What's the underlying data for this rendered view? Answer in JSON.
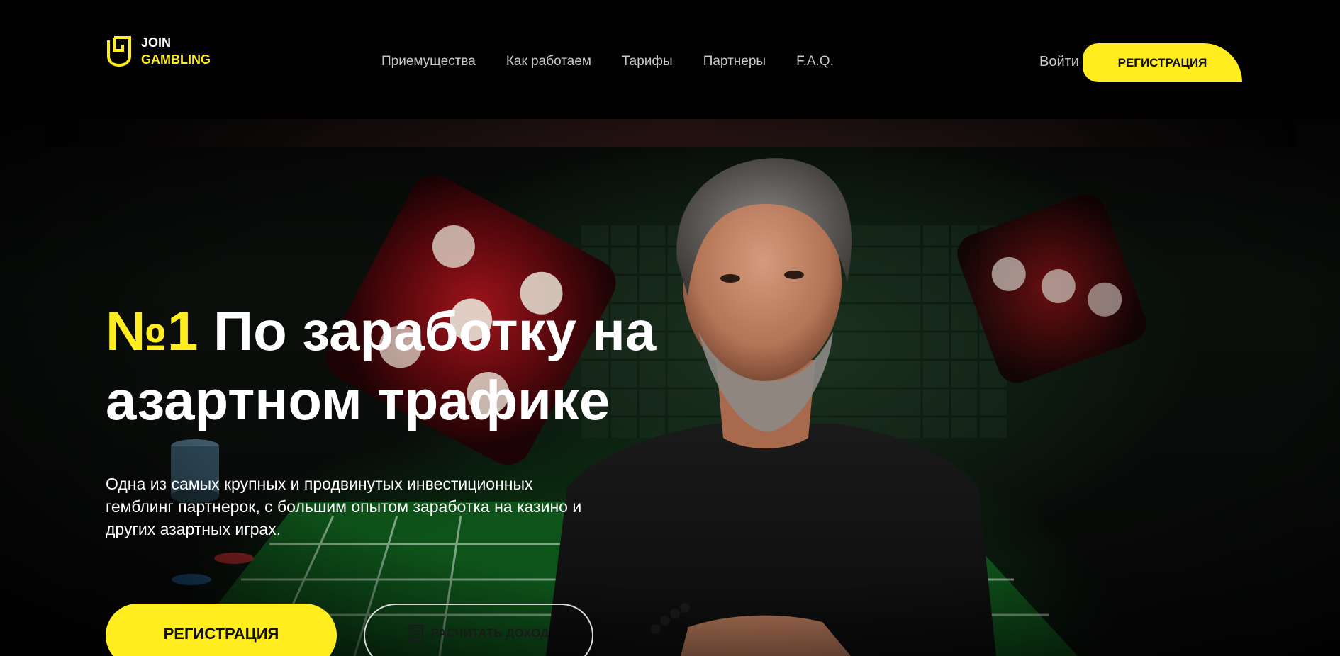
{
  "header": {
    "logo_line1": "JOIN",
    "logo_line2": "GAMBLING",
    "nav": [
      {
        "label": "Приемущества"
      },
      {
        "label": "Как работаем"
      },
      {
        "label": "Тарифы"
      },
      {
        "label": "Партнеры"
      },
      {
        "label": "F.A.Q."
      }
    ],
    "login_label": "Войти",
    "register_label": "РЕГИСТРАЦИЯ"
  },
  "hero": {
    "title_accent": "№1",
    "title_rest": " По заработку на азартном трафике",
    "description": "Одна из самых крупных и продвинутых инвестиционных гемблинг партнерок, с большим опытом заработка на казино и других азартных играх.",
    "register_label": "РЕГИСТРАЦИЯ",
    "calc_label": "РАСЧИТАТЬ ДОХОД",
    "calc_icon": "calculator-icon"
  },
  "colors": {
    "accent": "#ffed1f",
    "background": "#020202",
    "nav_text": "#c9c9c9",
    "table_green": "#0d4a16"
  }
}
